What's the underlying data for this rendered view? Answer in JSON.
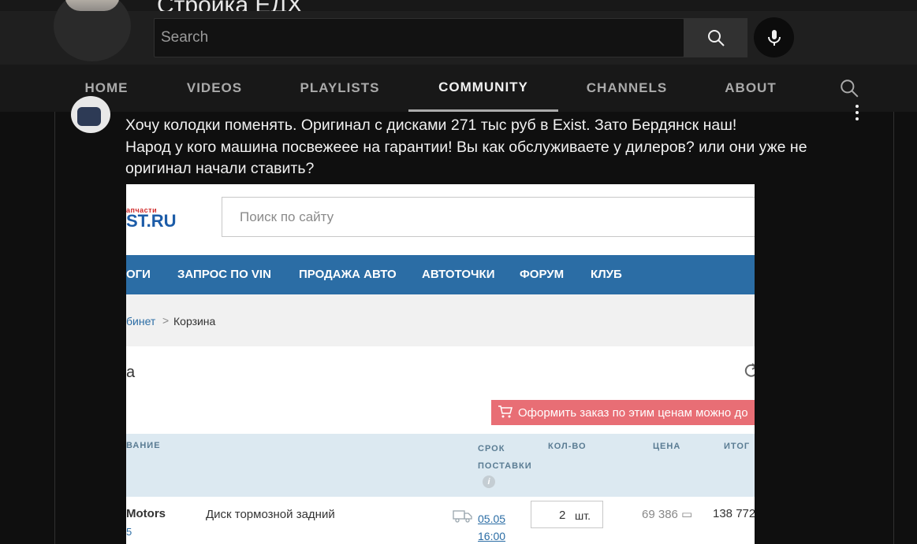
{
  "channel": {
    "title": "Стройка ЕДХ"
  },
  "masthead": {
    "search_placeholder": "Search",
    "search_icon": "search-icon",
    "mic_icon": "microphone-icon"
  },
  "tabs": [
    {
      "label": "HOME",
      "active": false
    },
    {
      "label": "VIDEOS",
      "active": false
    },
    {
      "label": "PLAYLISTS",
      "active": false
    },
    {
      "label": "COMMUNITY",
      "active": true
    },
    {
      "label": "CHANNELS",
      "active": false
    },
    {
      "label": "ABOUT",
      "active": false
    }
  ],
  "post": {
    "lines": [
      "Хочу колодки поменять. Оригинал с дисками 271 тыс руб в Exist. Зато Бердянск наш!",
      "Народ у кого машина посвежеее на гарантии! Вы как обслуживаете у дилеров? или они уже не",
      "оригинал начали ставить?"
    ],
    "image": {
      "logo_small": "апчасти",
      "logo_big": "ST.RU",
      "site_search_placeholder": "Поиск по сайту",
      "nav": [
        "ОГИ",
        "ЗАПРОС ПО VIN",
        "ПРОДАЖА АВТО",
        "АВТОТОЧКИ",
        "ФОРУМ",
        "КЛУБ"
      ],
      "breadcrumb": [
        "бинет",
        ">",
        "Корзина"
      ],
      "heading": "а",
      "order_banner": "Оформить заказ по этим ценам можно до",
      "table_headers": {
        "name": "ВАНИЕ",
        "delivery_line1": "СРОК",
        "delivery_line2": "ПОСТАВКИ",
        "qty": "КОЛ-ВО",
        "price": "ЦЕНА",
        "total": "ИТОГ"
      },
      "info_icon": "i",
      "row": {
        "brand": "Motors",
        "brand_sub": "5",
        "description": "Диск тормозной задний",
        "date": "05.05",
        "time": "16:00",
        "qty": "2",
        "unit": "шт.",
        "price": "69 386 ▭",
        "total": "138 772"
      }
    }
  },
  "colors": {
    "background": "#0f0f0f",
    "masthead": "#1f1f1f",
    "exist_blue": "#2b6da5",
    "banner_red": "#e86e75"
  }
}
